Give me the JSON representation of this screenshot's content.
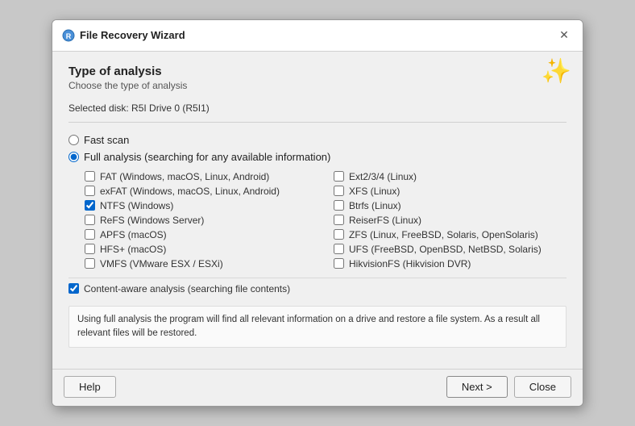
{
  "dialog": {
    "title": "File Recovery Wizard",
    "close_label": "✕"
  },
  "header": {
    "type_of_analysis": "Type of analysis",
    "subtitle": "Choose the type of analysis",
    "wizard_icon": "✨"
  },
  "selected_disk": "Selected disk: R5I Drive 0 (R5I1)",
  "analysis_options": {
    "fast_scan_label": "Fast scan",
    "full_analysis_label": "Full analysis (searching for any available information)"
  },
  "file_systems": {
    "left_column": [
      {
        "id": "fat",
        "label": "FAT (Windows, macOS, Linux, Android)",
        "checked": false
      },
      {
        "id": "exfat",
        "label": "exFAT (Windows, macOS, Linux, Android)",
        "checked": false
      },
      {
        "id": "ntfs",
        "label": "NTFS (Windows)",
        "checked": true
      },
      {
        "id": "refs",
        "label": "ReFS (Windows Server)",
        "checked": false
      },
      {
        "id": "apfs",
        "label": "APFS (macOS)",
        "checked": false
      },
      {
        "id": "hfsplus",
        "label": "HFS+ (macOS)",
        "checked": false
      },
      {
        "id": "vmfs",
        "label": "VMFS (VMware ESX / ESXi)",
        "checked": false
      }
    ],
    "right_column": [
      {
        "id": "ext234",
        "label": "Ext2/3/4 (Linux)",
        "checked": false
      },
      {
        "id": "xfs",
        "label": "XFS (Linux)",
        "checked": false
      },
      {
        "id": "btrfs",
        "label": "Btrfs (Linux)",
        "checked": false
      },
      {
        "id": "reiserfs",
        "label": "ReiserFS (Linux)",
        "checked": false
      },
      {
        "id": "zfs",
        "label": "ZFS (Linux, FreeBSD, Solaris, OpenSolaris)",
        "checked": false
      },
      {
        "id": "ufs",
        "label": "UFS (FreeBSD, OpenBSD, NetBSD, Solaris)",
        "checked": false
      },
      {
        "id": "hikvision",
        "label": "HikvisionFS (Hikvision DVR)",
        "checked": false
      }
    ]
  },
  "content_aware": {
    "label": "Content-aware analysis (searching file contents)",
    "checked": true
  },
  "description": "Using full analysis the program will find all relevant information on a drive and restore a file system. As a result all relevant files will be restored.",
  "footer": {
    "help_label": "Help",
    "next_label": "Next >",
    "close_label": "Close"
  }
}
